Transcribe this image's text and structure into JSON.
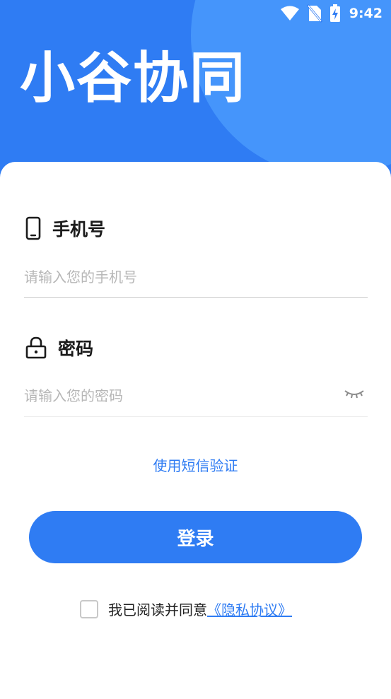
{
  "status_bar": {
    "time": "9:42",
    "icons": [
      "wifi-icon",
      "no-sim-icon",
      "battery-charging-icon"
    ]
  },
  "header": {
    "title": "小谷协同",
    "colors": {
      "background": "#2f7cf3",
      "circle": "#4595fb"
    }
  },
  "phone_field": {
    "label": "手机号",
    "placeholder": "请输入您的手机号",
    "value": "",
    "icon": "phone-icon"
  },
  "password_field": {
    "label": "密码",
    "placeholder": "请输入您的密码",
    "value": "",
    "icon": "lock-icon",
    "toggle_icon": "eye-closed-icon"
  },
  "sms_login": {
    "label": "使用短信验证"
  },
  "login_button": {
    "label": "登录"
  },
  "agreement": {
    "checked": false,
    "text": "我已阅读并同意",
    "link": "《隐私协议》"
  },
  "theme": {
    "accent": "#2f7cf3"
  }
}
